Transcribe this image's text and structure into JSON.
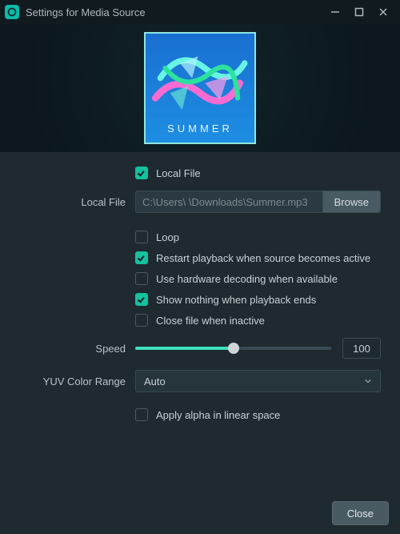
{
  "window": {
    "title": "Settings for Media Source"
  },
  "preview": {
    "cover_text": "SUMMER"
  },
  "options": {
    "local_file_checkbox": {
      "label": "Local File",
      "checked": true
    },
    "local_file_field": {
      "label": "Local File",
      "value": "C:\\Users\\            \\Downloads\\Summer.mp3",
      "browse_label": "Browse"
    },
    "loop": {
      "label": "Loop",
      "checked": false
    },
    "restart_playback": {
      "label": "Restart playback when source becomes active",
      "checked": true
    },
    "hw_decode": {
      "label": "Use hardware decoding when available",
      "checked": false
    },
    "show_nothing": {
      "label": "Show nothing when playback ends",
      "checked": true
    },
    "close_inactive": {
      "label": "Close file when inactive",
      "checked": false
    },
    "speed": {
      "label": "Speed",
      "value": "100",
      "percent": 50
    },
    "yuv_range": {
      "label": "YUV Color Range",
      "value": "Auto"
    },
    "apply_alpha": {
      "label": "Apply alpha in linear space",
      "checked": false
    }
  },
  "footer": {
    "close_label": "Close"
  },
  "colors": {
    "accent": "#14c19f",
    "bg": "#1e2a30"
  }
}
